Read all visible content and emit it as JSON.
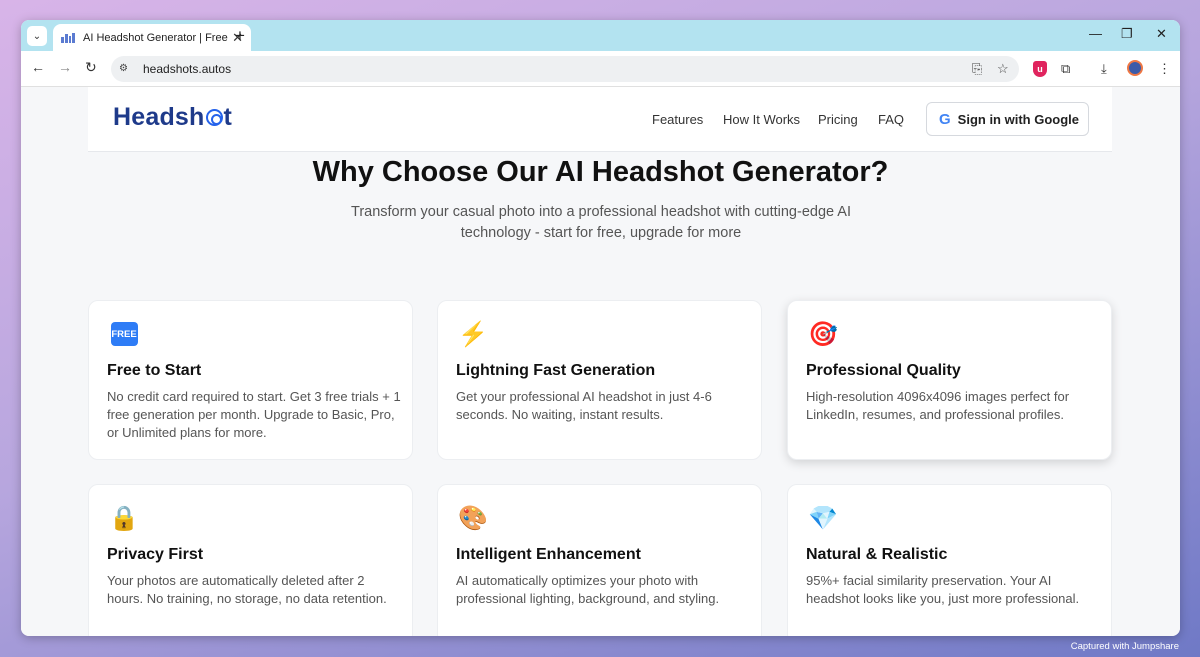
{
  "browser": {
    "tab_title": "AI Headshot Generator | Free Tr",
    "url": "headshots.autos",
    "icons": {
      "tab_menu": "chevron-down-icon",
      "close": "close-icon",
      "new_tab": "plus-icon",
      "minimize": "minimize-icon",
      "restore": "restore-icon",
      "window_close": "close-icon",
      "back": "arrow-left-icon",
      "forward": "arrow-right-icon",
      "reload": "reload-icon",
      "site_info": "site-settings-icon",
      "install": "install-app-icon",
      "bookmark": "star-icon",
      "extensions": "puzzle-icon",
      "downloads": "download-icon",
      "menu": "kebab-menu-icon"
    }
  },
  "header": {
    "logo_a": "Headsh",
    "logo_b": "t",
    "nav": [
      "Features",
      "How It Works",
      "Pricing",
      "FAQ"
    ],
    "signin": "Sign in with Google",
    "google_letter": "G"
  },
  "hero": {
    "title": "Why Choose Our AI Headshot Generator?",
    "subtitle": "Transform your casual photo into a professional headshot with cutting-edge AI technology - start for free, upgrade for more"
  },
  "features": [
    {
      "icon": "free-icon",
      "badge": "FREE",
      "title": "Free to Start",
      "desc": "No credit card required to start. Get 3 free trials + 1 free generation per month. Upgrade to Basic, Pro, or Unlimited plans for more."
    },
    {
      "icon": "lightning-icon",
      "glyph": "⚡",
      "title": "Lightning Fast Generation",
      "desc": "Get your professional AI headshot in just 4-6 seconds. No waiting, instant results."
    },
    {
      "icon": "target-icon",
      "glyph": "🎯",
      "title": "Professional Quality",
      "desc": "High-resolution 4096x4096 images perfect for LinkedIn, resumes, and professional profiles."
    },
    {
      "icon": "lock-icon",
      "glyph": "🔒",
      "title": "Privacy First",
      "desc": "Your photos are automatically deleted after 2 hours. No training, no storage, no data retention."
    },
    {
      "icon": "palette-icon",
      "glyph": "🎨",
      "title": "Intelligent Enhancement",
      "desc": "AI automatically optimizes your photo with professional lighting, background, and styling."
    },
    {
      "icon": "diamond-icon",
      "glyph": "💎",
      "title": "Natural & Realistic",
      "desc": "95%+ facial similarity preservation. Your AI headshot looks like you, just more professional."
    }
  ],
  "watermark": "Captured with Jumpshare"
}
